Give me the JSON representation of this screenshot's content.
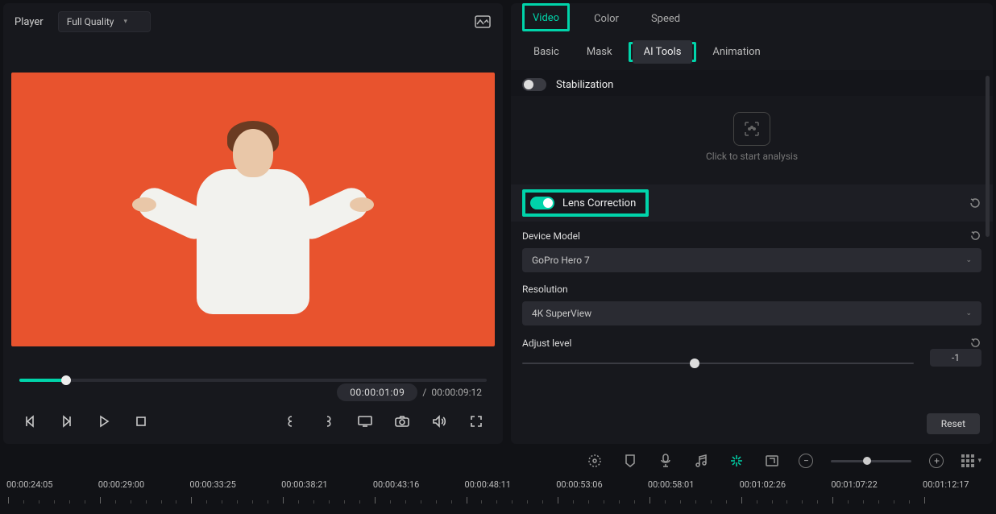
{
  "player": {
    "label": "Player",
    "quality": "Full Quality",
    "current_time": "00:00:01:09",
    "total_time": "00:00:09:12",
    "sep": "/"
  },
  "tabs_main": {
    "video": "Video",
    "color": "Color",
    "speed": "Speed"
  },
  "tabs_sub": {
    "basic": "Basic",
    "mask": "Mask",
    "ai": "AI Tools",
    "anim": "Animation"
  },
  "stabilization": {
    "label": "Stabilization",
    "hint": "Click to start analysis"
  },
  "lens": {
    "label": "Lens Correction"
  },
  "device": {
    "label": "Device Model",
    "value": "GoPro Hero 7"
  },
  "resolution": {
    "label": "Resolution",
    "value": "4K SuperView"
  },
  "adjust": {
    "label": "Adjust level",
    "value": "-1"
  },
  "reset_btn": "Reset",
  "timeline_labels": [
    "00:00:24:05",
    "00:00:29:00",
    "00:00:33:25",
    "00:00:38:21",
    "00:00:43:16",
    "00:00:48:11",
    "00:00:53:06",
    "00:00:58:01",
    "00:01:02:26",
    "00:01:07:22",
    "00:01:12:17"
  ]
}
